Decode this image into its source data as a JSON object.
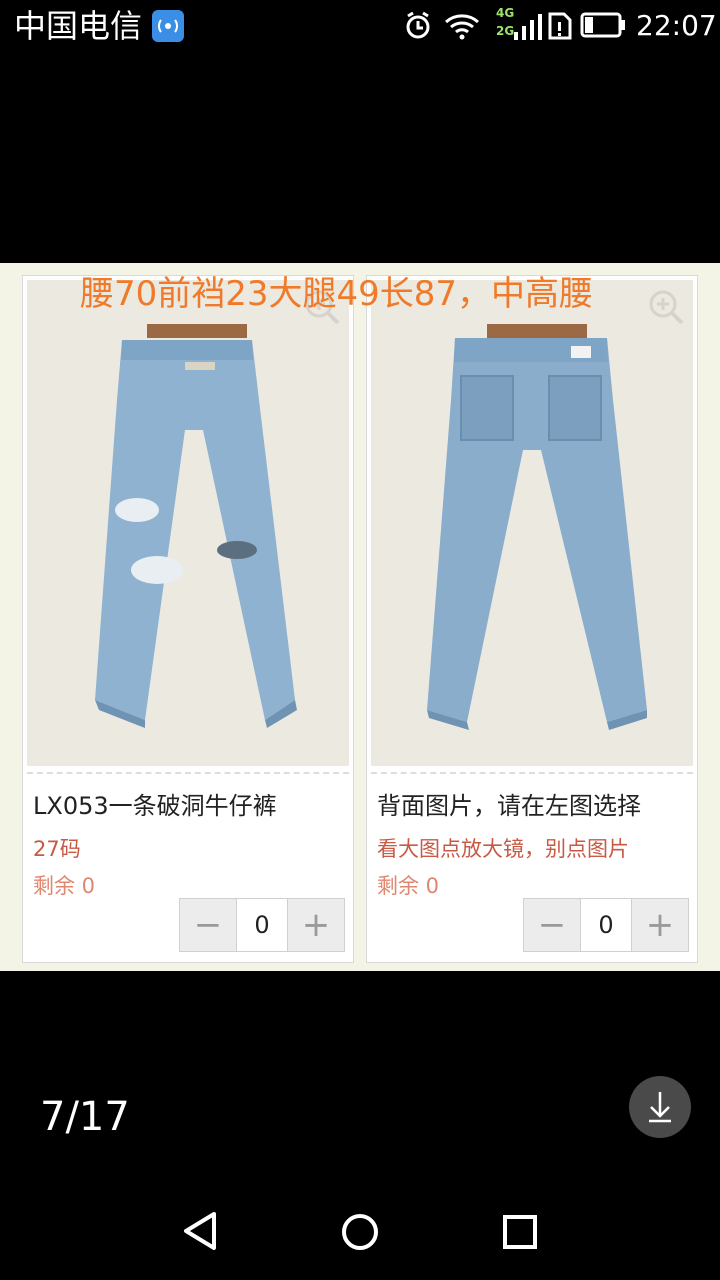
{
  "status_bar": {
    "carrier": "中国电信",
    "net_4g": "4G",
    "net_2g": "2G",
    "time": "22:07"
  },
  "overlay_caption": "腰70前裆23大腿49长87，中高腰",
  "products": [
    {
      "title": "LX053一条破洞牛仔裤",
      "size": "27码",
      "stock": "剩余 0",
      "quantity": "0"
    },
    {
      "title": "背面图片，请在左图选择",
      "size": "看大图点放大镜，别点图片",
      "stock": "剩余 0",
      "quantity": "0"
    }
  ],
  "stepper": {
    "minus": "−",
    "plus": "+"
  },
  "viewer": {
    "page_indicator": "7/17"
  },
  "icons": [
    "hd-icon",
    "alarm-icon",
    "wifi-icon",
    "signal-icon",
    "sim-icon",
    "battery-icon",
    "zoom-icon",
    "download-icon",
    "back-icon",
    "home-icon",
    "recents-icon"
  ]
}
